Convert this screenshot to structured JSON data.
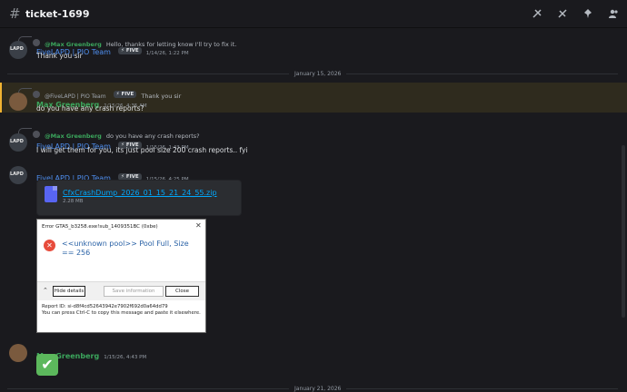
{
  "header": {
    "channel_name": "ticket-1699"
  },
  "messages": [
    {
      "reply": {
        "mention": "@Max Greenberg",
        "text": "Hello, thanks for letting know  I'll try to fix it."
      },
      "author": "FiveLAPD | PIO Team",
      "tag": "FIVE",
      "timestamp": "1/14/26, 1:22 PM",
      "text": "Thank you sir"
    },
    {
      "reply": {
        "mention": "@FiveLAPD | PIO Team",
        "tag": "FIVE",
        "text": "Thank you sir"
      },
      "author": "Max Greenberg",
      "timestamp": "1/15/26, 4:35 AM",
      "text": "do you have any crash reports?"
    },
    {
      "reply": {
        "mention": "@Max Greenberg",
        "text": "do you have any crash reports?"
      },
      "author": "FiveLAPD | PIO Team",
      "tag": "FIVE",
      "timestamp": "1/15/26, 1:43 PM",
      "text": "I will get them for you, its just pool size 200 crash reports.. fyi"
    },
    {
      "author": "FiveLAPD | PIO Team",
      "tag": "FIVE",
      "timestamp": "1/15/26, 4:25 PM"
    },
    {
      "author": "Max Greenberg",
      "timestamp": "1/15/26, 4:43 PM"
    }
  ],
  "date_divider_1": "January 15, 2026",
  "date_divider_2": "January 21, 2026",
  "attachment": {
    "filename": "CfxCrashDump_2026_01_15_21_24_55.zip",
    "size": "2.28 MB"
  },
  "dialog": {
    "title": "Error GTA5_b3258.exe!sub_1409351BC (0xbe)",
    "message": "<<unknown pool>> Pool Full, Size == 256",
    "hide_details": "Hide details",
    "save_information": "Save information",
    "close": "Close",
    "report_id": "Report ID: si-d8f4cd52643942e7902f692d0a64dd79",
    "copy_hint": "You can press Ctrl-C to copy this message and paste it elsewhere."
  },
  "reaction": {
    "emoji": "✔"
  },
  "colors": {
    "accent_blue": "#4f8ff0",
    "accent_green": "#3ba55c",
    "highlight": "#f0b232"
  }
}
